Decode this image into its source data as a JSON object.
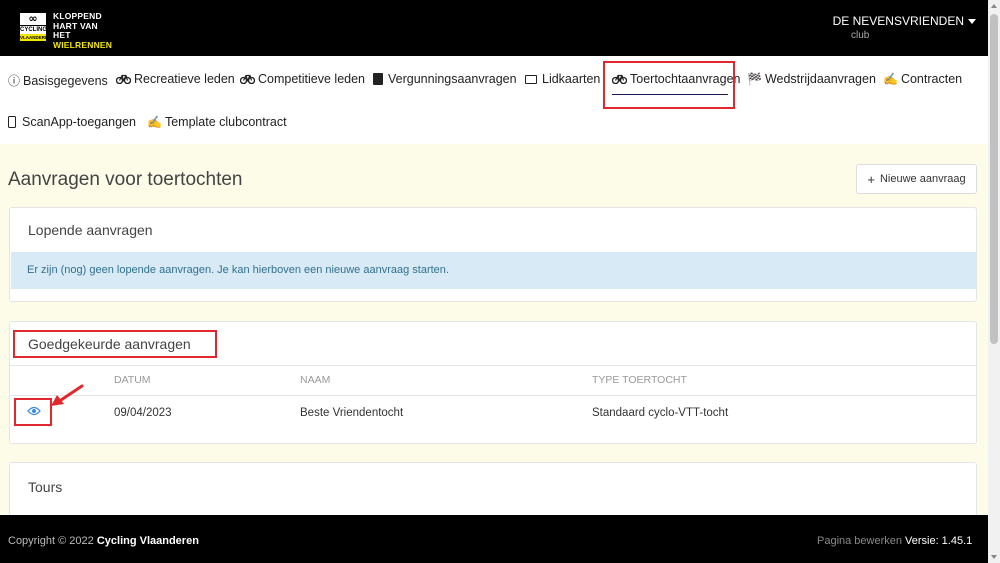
{
  "header": {
    "logo_lines": [
      "KLOPPEND",
      "HART VAN HET",
      "WIELRENNEN"
    ],
    "logo_badge_top": "CYCLING",
    "logo_badge_bottom": "VLAANDEREN",
    "club_name": "DE NEVENSVRIENDEN",
    "club_role": "club"
  },
  "nav": {
    "items": [
      {
        "label": "Basisgegevens",
        "icon": "info-circle-icon"
      },
      {
        "label": "Recreatieve leden",
        "icon": "bicycle-icon"
      },
      {
        "label": "Competitieve leden",
        "icon": "bicycle-icon"
      },
      {
        "label": "Vergunningsaanvragen",
        "icon": "license-icon"
      },
      {
        "label": "Lidkaarten",
        "icon": "card-icon"
      },
      {
        "label": "Toertochtaanvragen",
        "icon": "bicycle-icon",
        "active": true
      },
      {
        "label": "Wedstrijdaanvragen",
        "icon": "checkered-flag-icon"
      },
      {
        "label": "Contracten",
        "icon": "contract-icon"
      },
      {
        "label": "ScanApp-toegangen",
        "icon": "phone-icon"
      },
      {
        "label": "Template clubcontract",
        "icon": "contract-icon"
      }
    ]
  },
  "main": {
    "title": "Aanvragen voor toertochten",
    "new_button": "Nieuwe aanvraag",
    "running": {
      "title": "Lopende aanvragen",
      "empty_message": "Er zijn (nog) geen lopende aanvragen. Je kan hierboven een nieuwe aanvraag starten."
    },
    "approved": {
      "title": "Goedgekeurde aanvragen",
      "columns": [
        "DATUM",
        "NAAM",
        "TYPE TOERTOCHT"
      ],
      "rows": [
        {
          "datum": "09/04/2023",
          "naam": "Beste Vriendentocht",
          "type": "Standaard cyclo-VTT-tocht"
        }
      ]
    },
    "tours": {
      "title": "Tours"
    }
  },
  "footer": {
    "copyright_prefix": "Copyright © 2022",
    "copyright_owner": "Cycling Vlaanderen",
    "edit_link": "Pagina bewerken",
    "separator": "·",
    "version": "Versie: 1.45.1"
  },
  "colors": {
    "accent_red": "#e0282e",
    "brand_yellow": "#f3e600",
    "info_bg": "#d8eaf6",
    "page_bg": "#fdfce8"
  }
}
